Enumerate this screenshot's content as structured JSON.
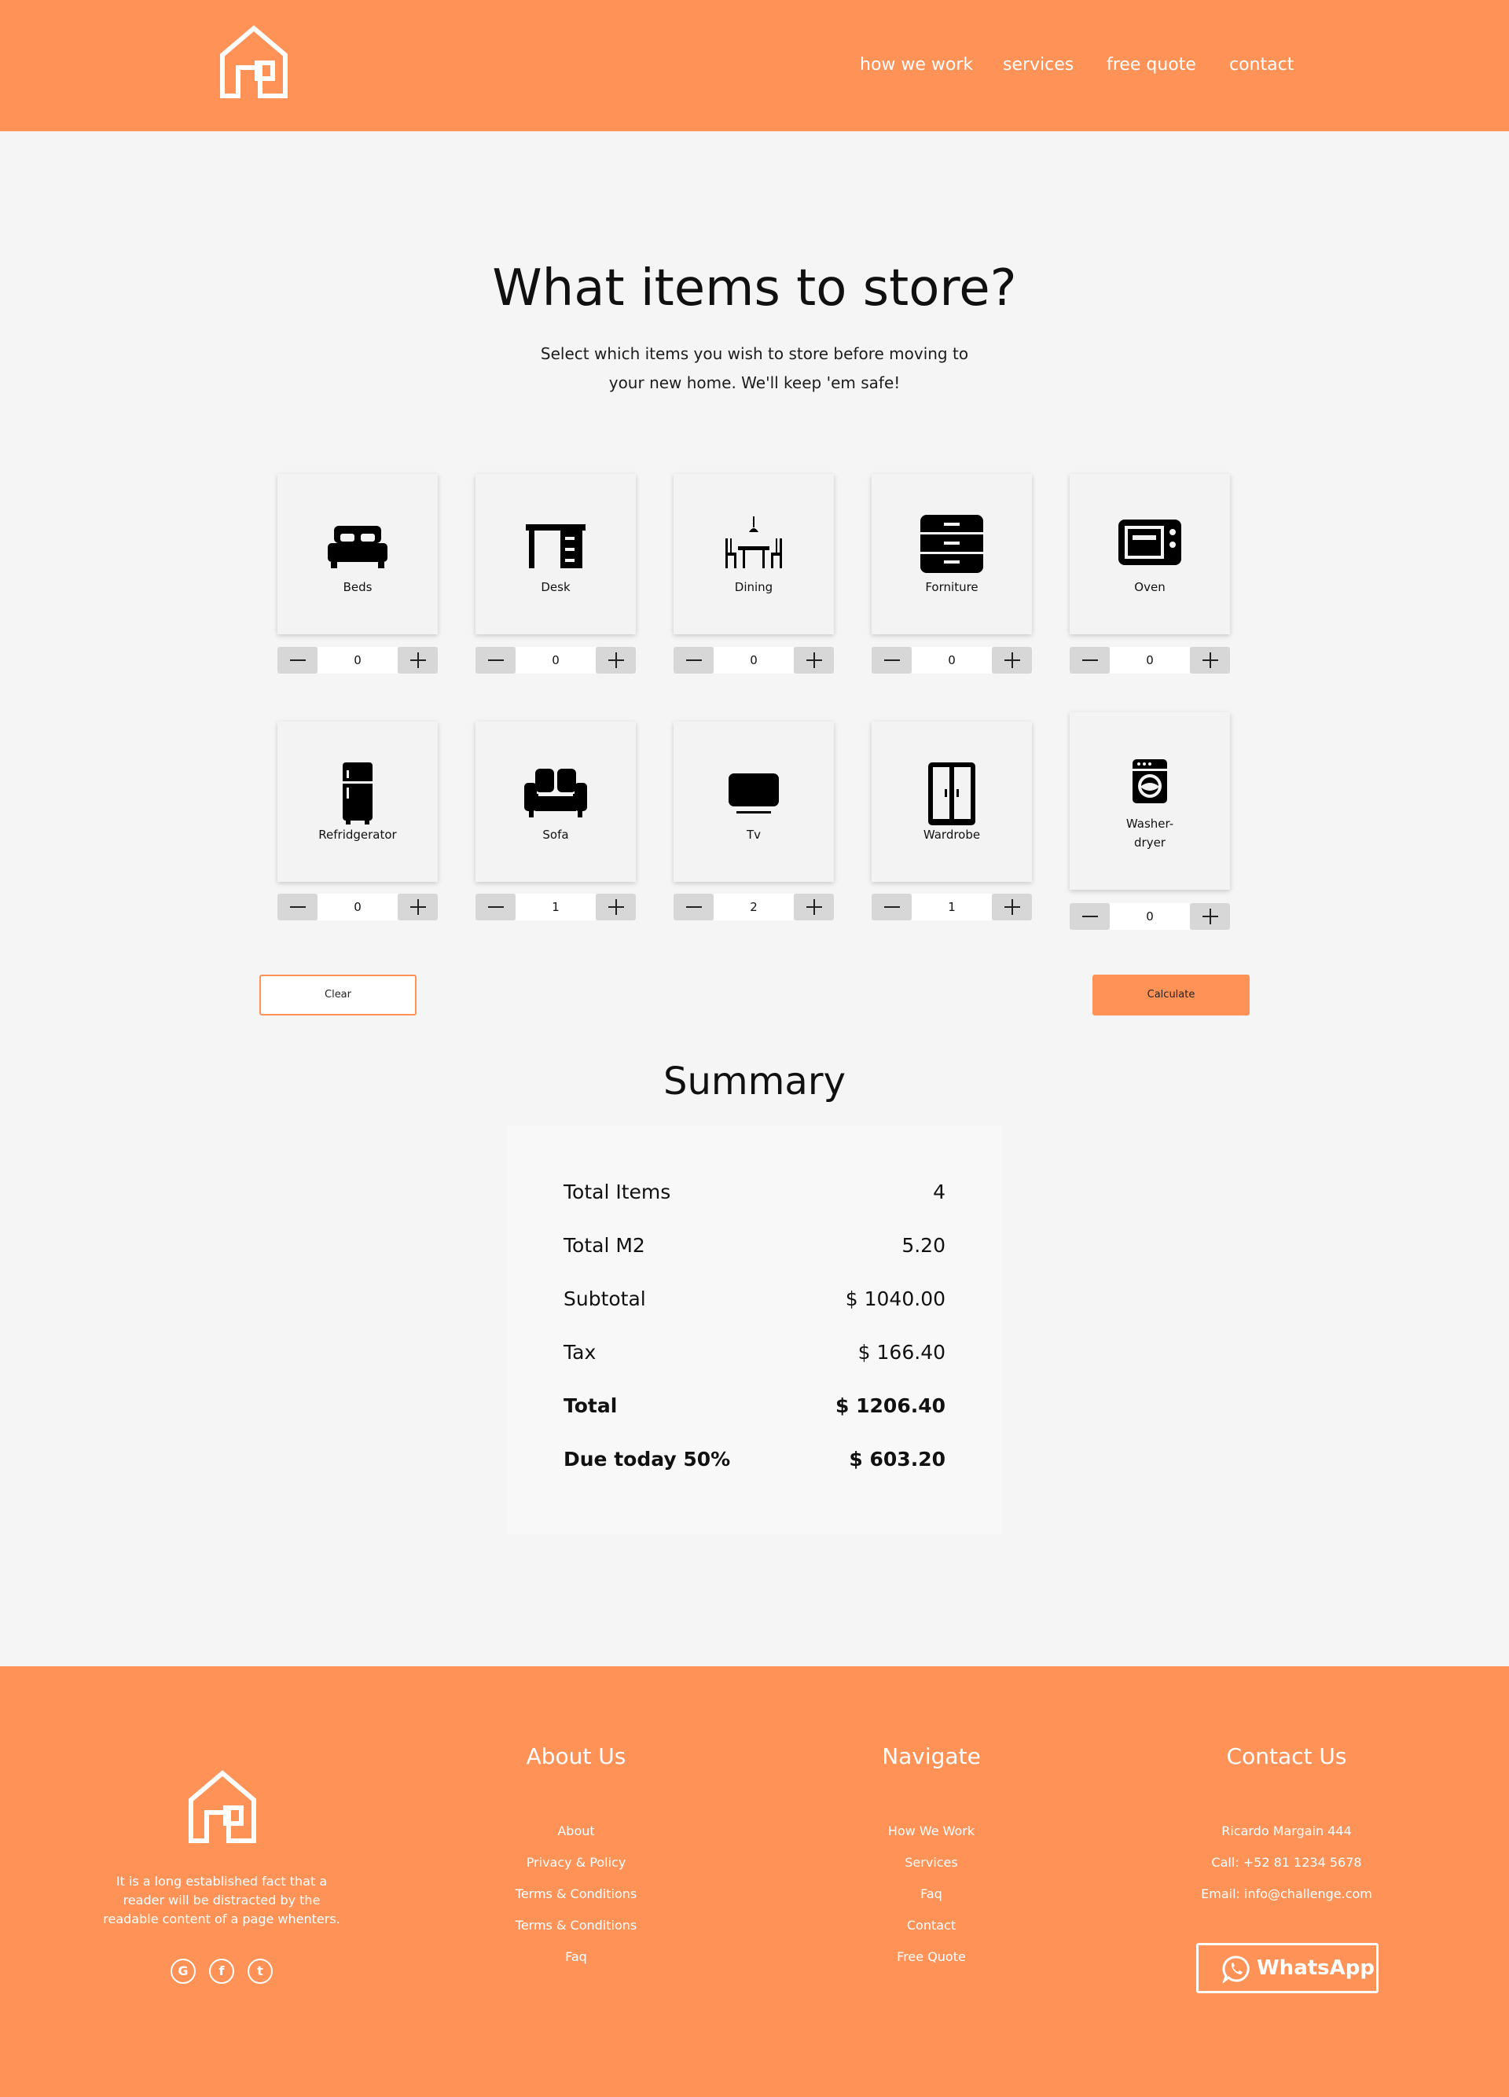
{
  "colors": {
    "brand": "#ff9257",
    "background": "#f5f5f5",
    "text": "#111111"
  },
  "header": {
    "logo_icon": "house-outline-icon",
    "nav": [
      {
        "label": "how we work"
      },
      {
        "label": "services"
      },
      {
        "label": "free quote"
      },
      {
        "label": "contact"
      }
    ]
  },
  "hero": {
    "title": "What items to store?",
    "subtitle_line1": "Select which items you wish to store before moving to",
    "subtitle_line2": "your new home. We'll keep 'em safe!"
  },
  "items": [
    {
      "label": "Beds",
      "icon": "bed-icon",
      "quantity": "0"
    },
    {
      "label": "Desk",
      "icon": "desk-icon",
      "quantity": "0"
    },
    {
      "label": "Dining",
      "icon": "dining-table-icon",
      "quantity": "0"
    },
    {
      "label": "Forniture",
      "icon": "drawers-icon",
      "quantity": "0"
    },
    {
      "label": "Oven",
      "icon": "oven-icon",
      "quantity": "0"
    },
    {
      "label": "Refridgerator",
      "icon": "refrigerator-icon",
      "quantity": "0"
    },
    {
      "label": "Sofa",
      "icon": "sofa-icon",
      "quantity": "1"
    },
    {
      "label": "Tv",
      "icon": "tv-icon",
      "quantity": "2"
    },
    {
      "label": "Wardrobe",
      "icon": "wardrobe-icon",
      "quantity": "1"
    },
    {
      "label_line1": "Washer-",
      "label_line2": "dryer",
      "icon": "washing-machine-icon",
      "quantity": "0"
    }
  ],
  "actions": {
    "clear_label": "Clear",
    "calculate_label": "Calculate"
  },
  "summary": {
    "title": "Summary",
    "rows": [
      {
        "label": "Total Items",
        "value": "4"
      },
      {
        "label": "Total M2",
        "value": "5.20"
      },
      {
        "label": "Subtotal",
        "value": "$ 1040.00"
      },
      {
        "label": "Tax",
        "value": "$ 166.40"
      },
      {
        "label": "Total",
        "value": "$ 1206.40"
      },
      {
        "label": "Due today 50%",
        "value": "$ 603.20"
      }
    ]
  },
  "footer": {
    "logo_icon": "house-outline-icon",
    "description_line1": "It is a long established fact that a",
    "description_line2": "reader will be distracted by the",
    "description_line3": "readable content of a page whenters.",
    "social": [
      {
        "icon": "google-icon",
        "glyph": "G"
      },
      {
        "icon": "facebook-icon",
        "glyph": "f"
      },
      {
        "icon": "twitter-icon",
        "glyph": "t"
      }
    ],
    "about": {
      "title": "About Us",
      "links": [
        "About",
        "Privacy & Policy",
        "Terms & Conditions",
        "Terms & Conditions",
        "Faq"
      ]
    },
    "navigate": {
      "title": "Navigate",
      "links": [
        "How We Work",
        "Services",
        "Faq",
        "Contact",
        "Free Quote"
      ]
    },
    "contact": {
      "title": "Contact Us",
      "lines": [
        "Ricardo Margain 444",
        "Call: +52 81 1234 5678",
        "Email: info@challenge.com"
      ]
    },
    "whatsapp_label": "WhatsApp"
  }
}
